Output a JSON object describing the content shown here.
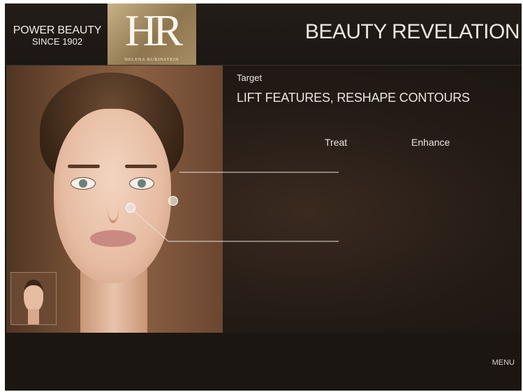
{
  "header": {
    "tagline_line1": "POWER BEAUTY",
    "tagline_line2": "SINCE 1902",
    "logo_monogram": "HR",
    "logo_name": "HELENA RUBINSTEIN",
    "title": "BEAUTY REVELATION"
  },
  "content": {
    "target_label": "Target",
    "headline": "LIFT FEATURES, RESHAPE CONTOURS",
    "tabs": [
      {
        "label": "Treat"
      },
      {
        "label": "Enhance"
      }
    ]
  },
  "footer": {
    "menu_label": "MENU"
  },
  "colors": {
    "background": "#1a1512",
    "logo_gold": "#b39c70",
    "text": "#ece6df"
  }
}
